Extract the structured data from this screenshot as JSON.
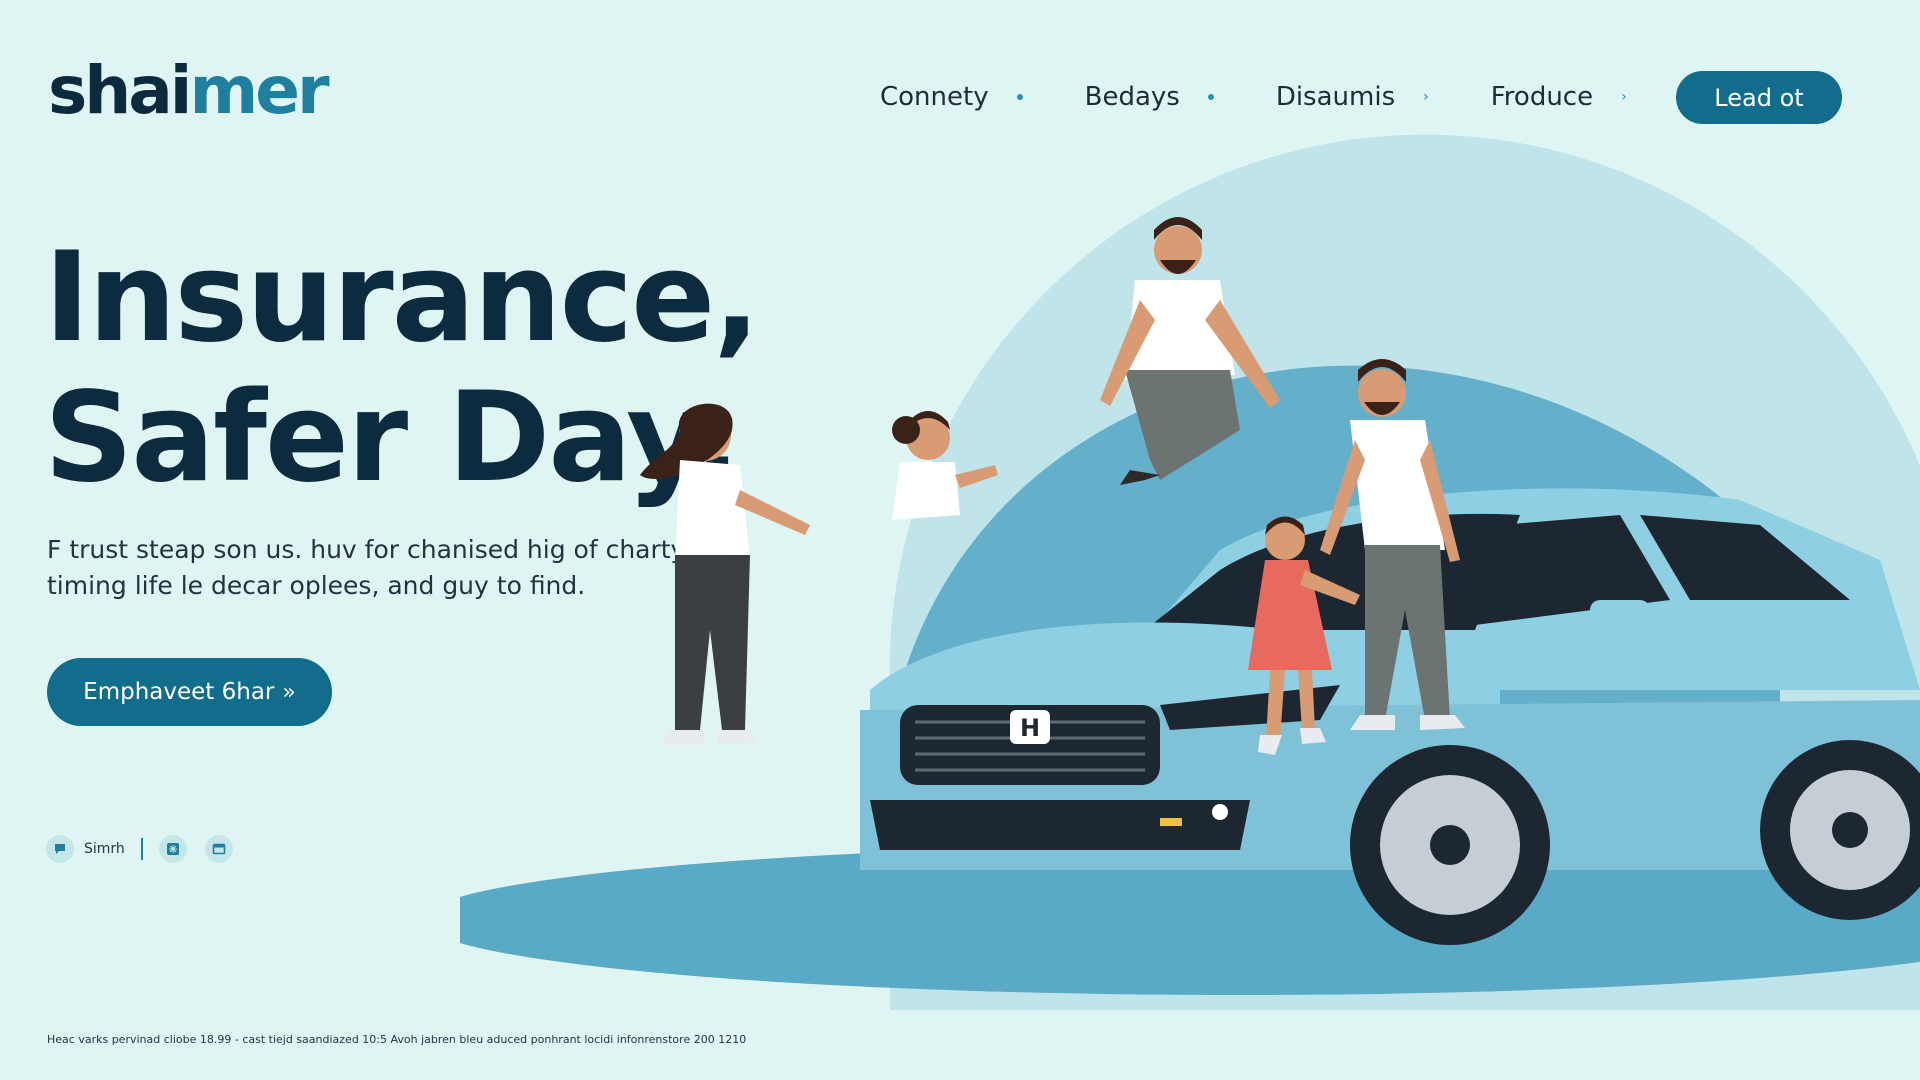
{
  "brand": {
    "logo_part_1": "shai",
    "logo_part_2": "mer",
    "accent_color": "#116d8b",
    "dark_color": "#0d2b3e",
    "background_color": "#dff5f4"
  },
  "nav": {
    "items": [
      {
        "label": "Connety",
        "marker": "dot"
      },
      {
        "label": "Bedays",
        "marker": "dot"
      },
      {
        "label": "Disaumis",
        "marker": "›"
      },
      {
        "label": "Froduce",
        "marker": "›"
      }
    ],
    "cta_label": "Lead ot"
  },
  "hero": {
    "title_line_1": "Insurance,",
    "title_line_2": "Safer Day.",
    "body": "F trust steap son us. huv for chanised hig of charty a timing life le decar oplees, and guy to find.",
    "cta_label": "Emphaveet 6har",
    "cta_icon": "double-chevron-right-icon"
  },
  "social": {
    "items": [
      {
        "icon": "chat-icon",
        "label": "Simrh"
      },
      {
        "icon": "grid-icon",
        "label": ""
      },
      {
        "icon": "window-icon",
        "label": ""
      }
    ]
  },
  "footer": {
    "note": "Heac varks pervinad cliobe 18.99 - cast tiejd saandiazed 10:5 Avoh jabren bleu aduced ponhrant locidi infonrenstore 200 1210"
  },
  "illustration": {
    "subject": "family-with-car-illustration",
    "car_badge": "H",
    "car_color": "#8ecfe3",
    "arc_color": "#5aa9c6"
  }
}
